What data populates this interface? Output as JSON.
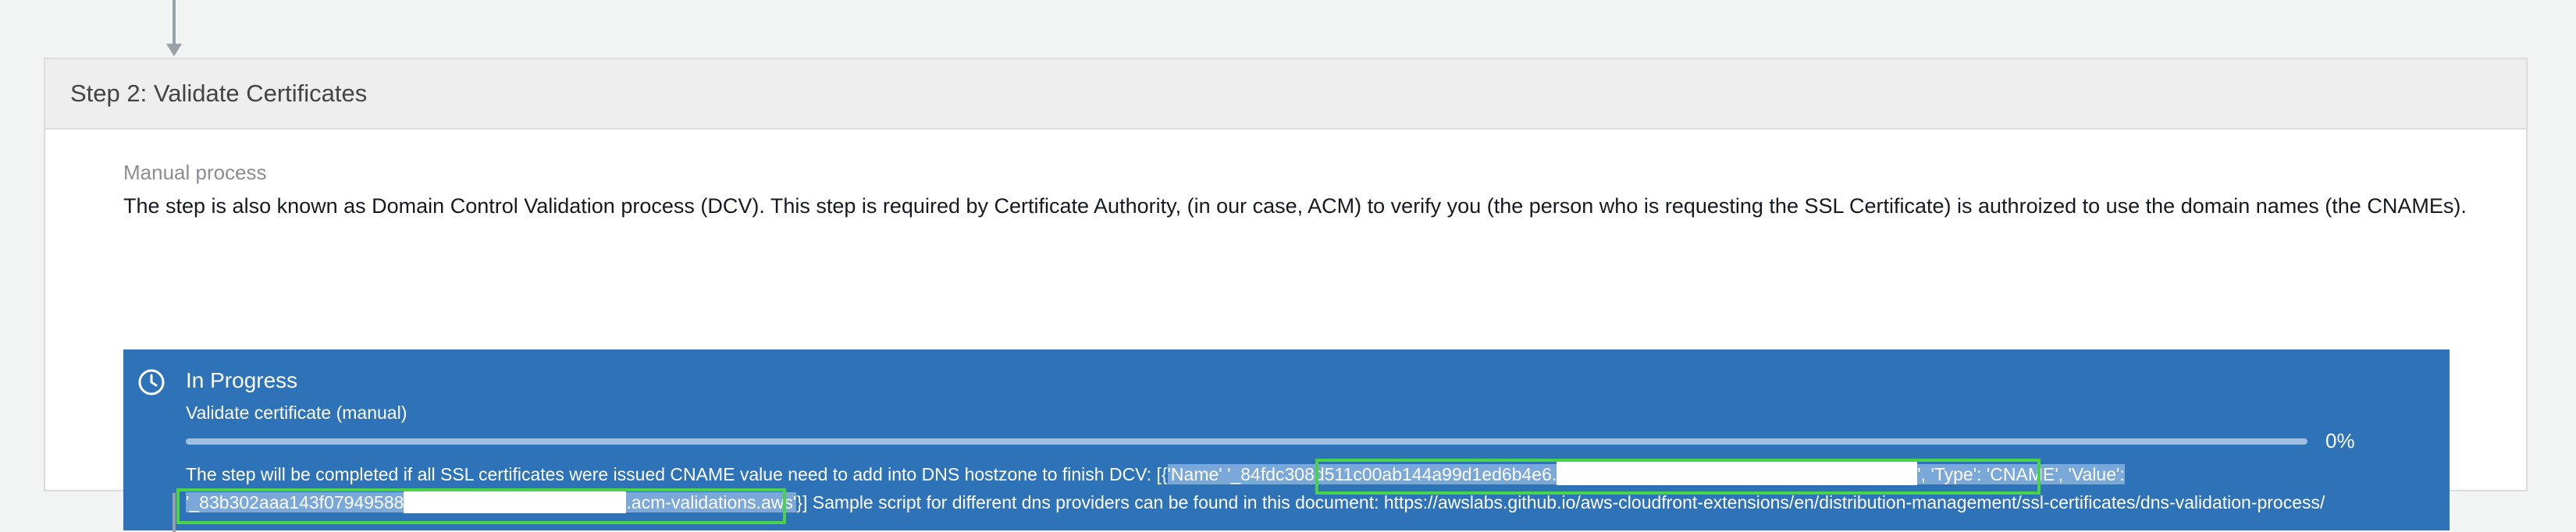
{
  "step": {
    "title": "Step 2: Validate Certificates"
  },
  "section": {
    "label": "Manual process",
    "description": "The step is also known as Domain Control Validation process (DCV). This step is required by Certificate Authority, (in our case, ACM) to verify you (the person who is requesting the SSL Certificate) is authroized to use the domain names (the CNAMEs)."
  },
  "status": {
    "title": "In Progress",
    "subtitle": "Validate certificate (manual)",
    "progress_value": 0,
    "progress_label": "0%",
    "message_prefix": "The step will be completed if all SSL certificates were issued CNAME value need to add into DNS hostzone to finish DCV: [{",
    "name_key": "'Name'",
    "name_value": "'_84fdc308d511c00ab144a99d1ed6b4e6.",
    "name_end": "',",
    "type_key": "'Type': 'CNAME', 'Value':",
    "value_start": "'_83b302aaa143f07949588",
    "value_end": ".acm-validations.aws",
    "value_close": "'",
    "message_suffix": "}] Sample script for different dns providers can be found in this document: https://awslabs.github.io/aws-cloudfront-extensions/en/distribution-management/ssl-certificates/dns-validation-process/"
  },
  "colors": {
    "banner": "#2e73b8",
    "highlight_box": "#48d34a",
    "header_bg": "#eeeeee"
  },
  "icons": {
    "status": "clock-icon"
  }
}
